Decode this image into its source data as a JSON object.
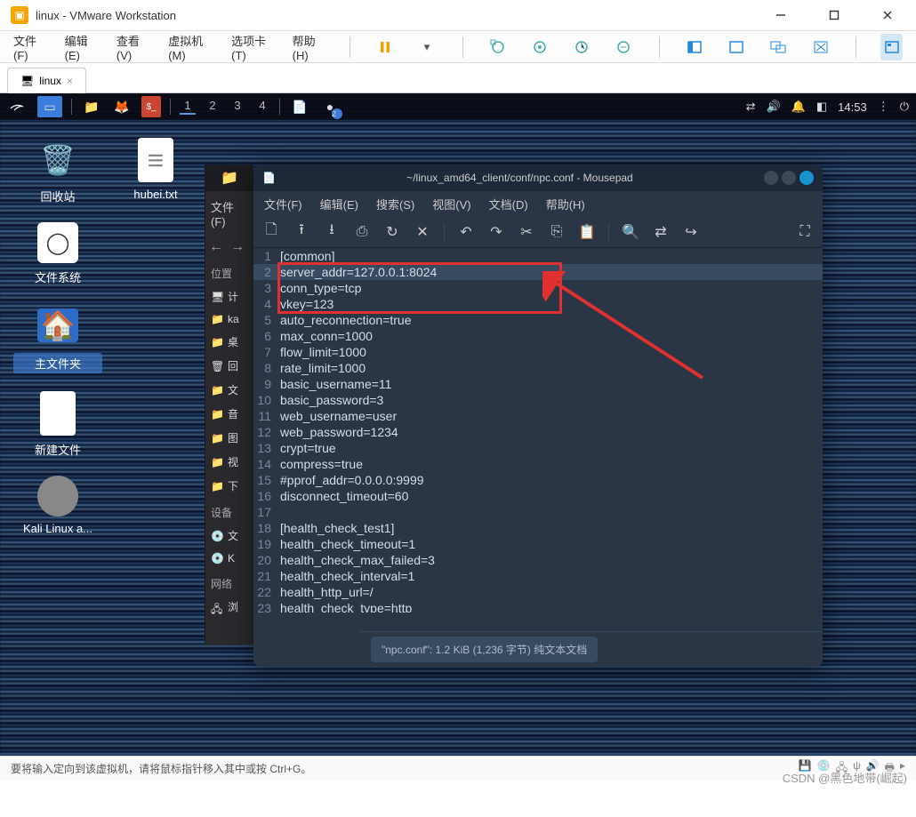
{
  "vmware": {
    "title": "linux - VMware Workstation",
    "menu": {
      "file": "文件(F)",
      "edit": "编辑(E)",
      "view": "查看(V)",
      "vm": "虚拟机(M)",
      "tabs": "选项卡(T)",
      "help": "帮助(H)"
    },
    "tab": {
      "name": "linux",
      "close": "×"
    },
    "status": "要将输入定向到该虚拟机，请将鼠标指针移入其中或按 Ctrl+G。"
  },
  "kali": {
    "workspaces": [
      "1",
      "2",
      "3",
      "4"
    ],
    "badge": "2",
    "time": "14:53",
    "icons": {
      "trash": "回收站",
      "hubei": "hubei.txt",
      "filesystem": "文件系统",
      "home": "主文件夹",
      "newfile": "新建文件",
      "kalilinux": "Kali Linux a..."
    }
  },
  "fm": {
    "menu": "文件(F)",
    "places": "位置",
    "items": {
      "computer": "计",
      "ka": "ka",
      "desktop": "桌",
      "trash": "回",
      "docs": "文",
      "music": "音",
      "pics": "图",
      "videos": "视",
      "downloads": "下"
    },
    "devices": "设备",
    "dev_items": {
      "docs": "文",
      "k": "K"
    },
    "network": "网络",
    "net_items": {
      "browse": "浏"
    }
  },
  "mousepad": {
    "title": "~/linux_amd64_client/conf/npc.conf - Mousepad",
    "menu": {
      "file": "文件(F)",
      "edit": "编辑(E)",
      "search": "搜索(S)",
      "view": "视图(V)",
      "doc": "文档(D)",
      "help": "帮助(H)"
    },
    "footer": "\"npc.conf\": 1.2 KiB (1,236 字节) 纯文本文档",
    "lines": [
      {
        "n": "1",
        "t": "[common]"
      },
      {
        "n": "2",
        "t": "server_addr=127.0.0.1:8024"
      },
      {
        "n": "3",
        "t": "conn_type=tcp"
      },
      {
        "n": "4",
        "t": "vkey=123"
      },
      {
        "n": "5",
        "t": "auto_reconnection=true"
      },
      {
        "n": "6",
        "t": "max_conn=1000"
      },
      {
        "n": "7",
        "t": "flow_limit=1000"
      },
      {
        "n": "8",
        "t": "rate_limit=1000"
      },
      {
        "n": "9",
        "t": "basic_username=11"
      },
      {
        "n": "10",
        "t": "basic_password=3"
      },
      {
        "n": "11",
        "t": "web_username=user"
      },
      {
        "n": "12",
        "t": "web_password=1234"
      },
      {
        "n": "13",
        "t": "crypt=true"
      },
      {
        "n": "14",
        "t": "compress=true"
      },
      {
        "n": "15",
        "t": "#pprof_addr=0.0.0.0:9999"
      },
      {
        "n": "16",
        "t": "disconnect_timeout=60"
      },
      {
        "n": "17",
        "t": ""
      },
      {
        "n": "18",
        "t": "[health_check_test1]"
      },
      {
        "n": "19",
        "t": "health_check_timeout=1"
      },
      {
        "n": "20",
        "t": "health_check_max_failed=3"
      },
      {
        "n": "21",
        "t": "health_check_interval=1"
      },
      {
        "n": "22",
        "t": "health_http_url=/"
      },
      {
        "n": "23",
        "t": "health_check_type=http"
      }
    ]
  },
  "watermark": "CSDN @黑色地带(崛起)"
}
